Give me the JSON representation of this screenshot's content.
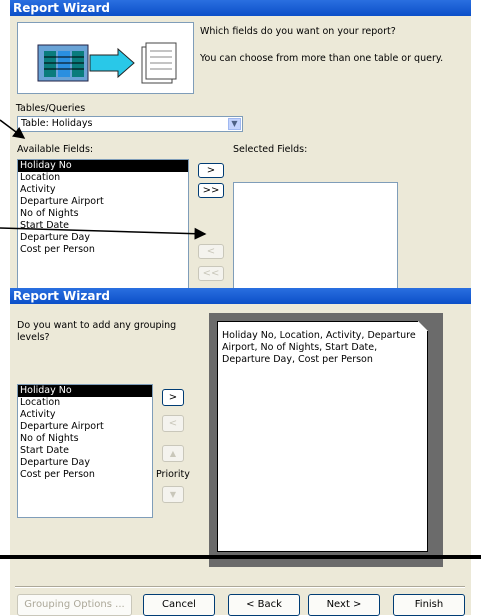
{
  "wizard1": {
    "title": "Report Wizard",
    "prompt": "Which fields do you want on your report?",
    "hint": "You can choose from more than one table or query.",
    "tables_label": "Tables/Queries",
    "tables_value": "Table: Holidays",
    "available_label": "Available Fields:",
    "selected_label": "Selected Fields:",
    "available_fields": [
      "Holiday No",
      "Location",
      "Activity",
      "Departure Airport",
      "No of Nights",
      "Start Date",
      "Departure Day",
      "Cost per Person"
    ],
    "selected_fields": [],
    "btn_add": ">",
    "btn_add_all": ">>",
    "btn_remove": "<",
    "btn_remove_all": "<<"
  },
  "wizard2": {
    "title": "Report Wizard",
    "prompt": "Do you want to add any grouping levels?",
    "fields": [
      "Holiday No",
      "Location",
      "Activity",
      "Departure Airport",
      "No of Nights",
      "Start Date",
      "Departure Day",
      "Cost per Person"
    ],
    "btn_add": ">",
    "btn_remove": "<",
    "priority_label": "Priority",
    "preview_text": "Holiday No, Location, Activity, Departure Airport, No of Nights, Start Date, Departure Day, Cost per Person",
    "grouping_options": "Grouping Options ...",
    "cancel": "Cancel",
    "back": "< Back",
    "next": "Next >",
    "finish": "Finish"
  },
  "colors": {
    "titlebar": "#0b4fc8",
    "dialog": "#ece9d8",
    "listbox_border": "#7f9db9"
  }
}
